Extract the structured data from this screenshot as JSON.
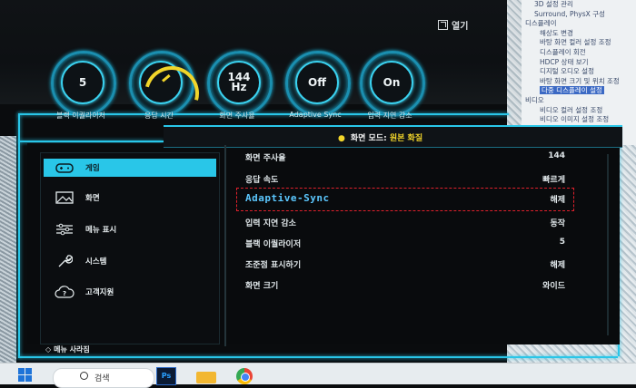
{
  "background": {
    "open_label": "열기",
    "tree_items": [
      "3D 설정 관리",
      "Surround, PhysX 구성",
      "디스플레이",
      "해상도 변경",
      "바탕 화면 컬러 설정 조정",
      "디스플레이 회전",
      "HDCP 상태 보기",
      "디지털 오디오 설정",
      "바탕 화면 크기 및 위치 조정",
      "다중 디스플레이 설정",
      "비디오",
      "비디오 컬러 설정 조정",
      "비디오 이미지 설정 조정"
    ],
    "tree_selected_index": 9
  },
  "osd": {
    "knobs": [
      {
        "value": "5",
        "label": "블랙 이퀄라이저"
      },
      {
        "value": "",
        "label": "응답 시간"
      },
      {
        "value": "144\nHz",
        "label": "화면 주사율"
      },
      {
        "value": "Off",
        "label": "Adaptive Sync"
      },
      {
        "value": "On",
        "label": "입력 지연 감소"
      }
    ],
    "banner": {
      "prefix": "화면 모드:",
      "value": "원본 화질"
    },
    "menu": [
      {
        "label": "게임",
        "icon": "gamepad-icon",
        "active": true
      },
      {
        "label": "화면",
        "icon": "picture-icon",
        "active": false
      },
      {
        "label": "메뉴 표시",
        "icon": "sliders-icon",
        "active": false
      },
      {
        "label": "시스템",
        "icon": "wrench-icon",
        "active": false
      },
      {
        "label": "고객지원",
        "icon": "help-cloud-icon",
        "active": false
      }
    ],
    "settings": [
      {
        "key": "화면 주사율",
        "value": "144"
      },
      {
        "key": "응답 속도",
        "value": "빠르게"
      },
      {
        "key": "Adaptive-Sync",
        "value": "해제"
      },
      {
        "key": "입력 지연 감소",
        "value": "동작"
      },
      {
        "key": "블랙 이퀄라이저",
        "value": "5"
      },
      {
        "key": "조준점 표시하기",
        "value": "해제"
      },
      {
        "key": "화면 크기",
        "value": "와이드"
      }
    ],
    "bottom_hint": "메뉴 사라짐",
    "colors": {
      "accent": "#29c6e8",
      "highlight_text": "#5cc8ff",
      "annotation": "#e0202c",
      "gauge": "#f2d52a"
    }
  },
  "taskbar": {
    "search_placeholder": "검색",
    "apps": [
      "photoshop-icon",
      "folder-icon",
      "chrome-icon"
    ],
    "ps_label": "Ps"
  }
}
